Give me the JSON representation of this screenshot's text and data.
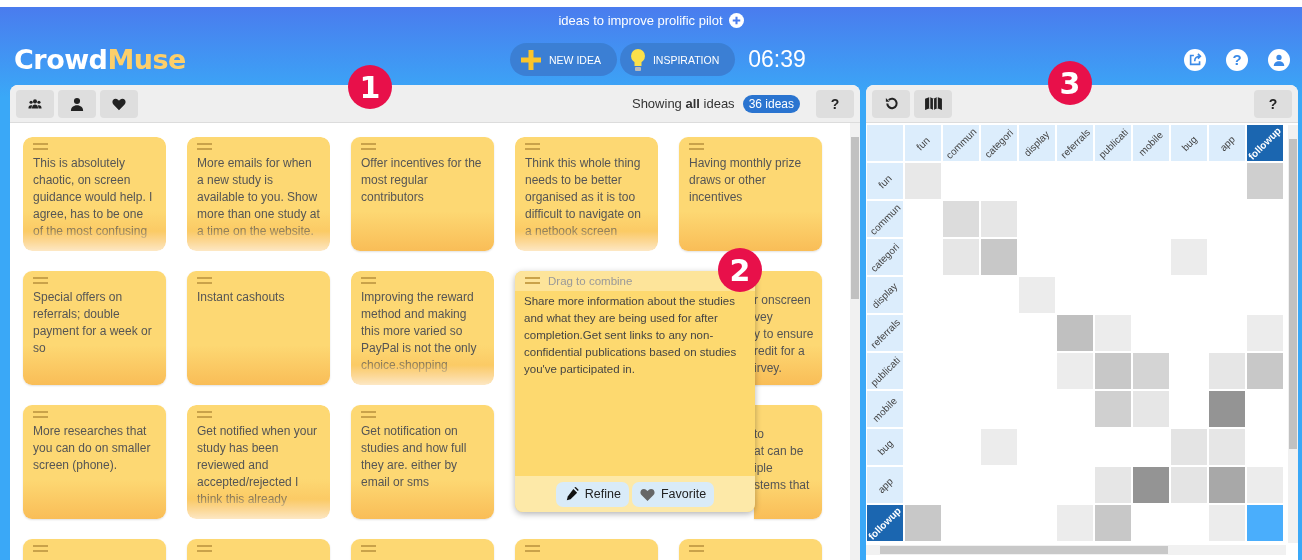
{
  "header": {
    "title": "ideas to improve prolific pilot",
    "logo": {
      "part_1": "Crowd",
      "part_2": "Muse"
    },
    "buttons": [
      {
        "label": "NEW IDEA",
        "kind": "plus"
      },
      {
        "label": "INSPIRATION",
        "kind": "bulb"
      }
    ],
    "timer": "06:39",
    "icons": [
      {
        "kind": "share"
      },
      {
        "kind": "help",
        "text": "?"
      },
      {
        "kind": "user"
      }
    ]
  },
  "ideas_panel": {
    "filters": [
      {
        "kind": "group"
      },
      {
        "kind": "user"
      },
      {
        "kind": "heart"
      }
    ],
    "status": "Showing **all** ideas",
    "count": "36 ideas",
    "help": "?",
    "cards": [
      {
        "kind": "faded",
        "text": "This is absolutely chaotic, on screen guidance would help. I agree, has to be one of the most confusing"
      },
      {
        "kind": "faded",
        "text": "More emails for when a new study is available to you. Show more than one study at a time on the website."
      },
      {
        "kind": "note",
        "text": "Offer incentives for the most regular contributors"
      },
      {
        "kind": "faded",
        "text": "Think this whole thing needs to be better organised as it is too difficult to navigate on a netbook screen"
      },
      {
        "kind": "note",
        "text": "Having monthly prize draws or other incentives"
      },
      {
        "kind": "note",
        "text": "Special offers on referrals; double payment for a week or so"
      },
      {
        "kind": "note",
        "text": "Instant cashouts"
      },
      {
        "kind": "faded",
        "text": "Improving the reward method and making this more varied so PayPal is not the only choice.shopping"
      },
      {
        "kind": "covered",
        "text": "r onscreen\nvey\ny to ensure\nredit for a\nirvey."
      },
      {
        "kind": "note",
        "text": "More researches that you can do on smaller screen (phone)."
      },
      {
        "kind": "faded",
        "text": "Get notified when your study has been reviewed and accepted/rejected I think this already"
      },
      {
        "kind": "note",
        "text": "Get notification on studies and how full they are. either by email or sms"
      },
      {
        "kind": "covered",
        "text": "to\nat can be\niple\nstems that"
      },
      {
        "kind": "stub"
      },
      {
        "kind": "stub"
      },
      {
        "kind": "stub"
      },
      {
        "kind": "stub"
      },
      {
        "kind": "stub"
      }
    ],
    "expanded_card": {
      "hint": "Drag to combine",
      "text": "Share more information about the studies and what they are being used for after completion.Get sent links to any non-confidential publications based on studies you've participated in.",
      "actions": [
        {
          "label": "Refine",
          "kind": "pencil"
        },
        {
          "label": "Favorite",
          "kind": "heart"
        }
      ]
    }
  },
  "matrix_panel": {
    "tools": [
      {
        "kind": "undo"
      },
      {
        "kind": "map"
      }
    ],
    "help": "?",
    "columns": [
      {
        "label": "fun",
        "selected": false
      },
      {
        "label": "commun",
        "selected": false
      },
      {
        "label": "categori",
        "selected": false
      },
      {
        "label": "display",
        "selected": false
      },
      {
        "label": "referrals",
        "selected": false
      },
      {
        "label": "publicati",
        "selected": false
      },
      {
        "label": "mobile",
        "selected": false
      },
      {
        "label": "bug",
        "selected": false
      },
      {
        "label": "app",
        "selected": false
      },
      {
        "label": "followup",
        "selected": true
      }
    ],
    "rows": [
      {
        "label": "fun",
        "selected": false,
        "cells": [
          {
            "color": "#e8e8e8"
          },
          null,
          null,
          null,
          null,
          null,
          null,
          null,
          null,
          {
            "color": "#cfcfcf"
          }
        ]
      },
      {
        "label": "commun",
        "selected": false,
        "cells": [
          null,
          {
            "color": "#dcdcdc"
          },
          {
            "color": "#e6e6e6"
          },
          null,
          null,
          null,
          null,
          null,
          null,
          null
        ]
      },
      {
        "label": "categori",
        "selected": false,
        "cells": [
          null,
          {
            "color": "#e6e6e6"
          },
          {
            "color": "#c8c8c8"
          },
          null,
          null,
          null,
          null,
          {
            "color": "#ececec"
          },
          null,
          null
        ]
      },
      {
        "label": "display",
        "selected": false,
        "cells": [
          null,
          null,
          null,
          {
            "color": "#ececec"
          },
          null,
          null,
          null,
          null,
          null,
          null
        ]
      },
      {
        "label": "referrals",
        "selected": false,
        "cells": [
          null,
          null,
          null,
          null,
          {
            "color": "#c0c0c0"
          },
          {
            "color": "#ececec"
          },
          null,
          null,
          null,
          {
            "color": "#ececec"
          }
        ]
      },
      {
        "label": "publicati",
        "selected": false,
        "cells": [
          null,
          null,
          null,
          null,
          {
            "color": "#ececec"
          },
          {
            "color": "#c8c8c8"
          },
          {
            "color": "#d4d4d4"
          },
          null,
          {
            "color": "#e6e6e6"
          },
          {
            "color": "#c8c8c8"
          }
        ]
      },
      {
        "label": "mobile",
        "selected": false,
        "cells": [
          null,
          null,
          null,
          null,
          null,
          {
            "color": "#d0d0d0"
          },
          {
            "color": "#e6e6e6"
          },
          null,
          {
            "color": "#949494"
          },
          null
        ]
      },
      {
        "label": "bug",
        "selected": false,
        "cells": [
          null,
          null,
          {
            "color": "#ececec"
          },
          null,
          null,
          null,
          null,
          {
            "color": "#e4e4e4"
          },
          {
            "color": "#e6e6e6"
          },
          null
        ]
      },
      {
        "label": "app",
        "selected": false,
        "cells": [
          null,
          null,
          null,
          null,
          null,
          {
            "color": "#e6e6e6"
          },
          {
            "color": "#949494"
          },
          {
            "color": "#e4e4e4"
          },
          {
            "color": "#a8a8a8"
          },
          {
            "color": "#ececec"
          }
        ]
      },
      {
        "label": "followup",
        "selected": true,
        "cells": [
          {
            "color": "#c8c8c8"
          },
          null,
          null,
          null,
          {
            "color": "#ececec"
          },
          {
            "color": "#c8c8c8"
          },
          null,
          null,
          {
            "color": "#ececec"
          },
          {
            "color": "#4aaefc"
          }
        ]
      }
    ]
  },
  "callouts": [
    "1",
    "2",
    "3"
  ]
}
